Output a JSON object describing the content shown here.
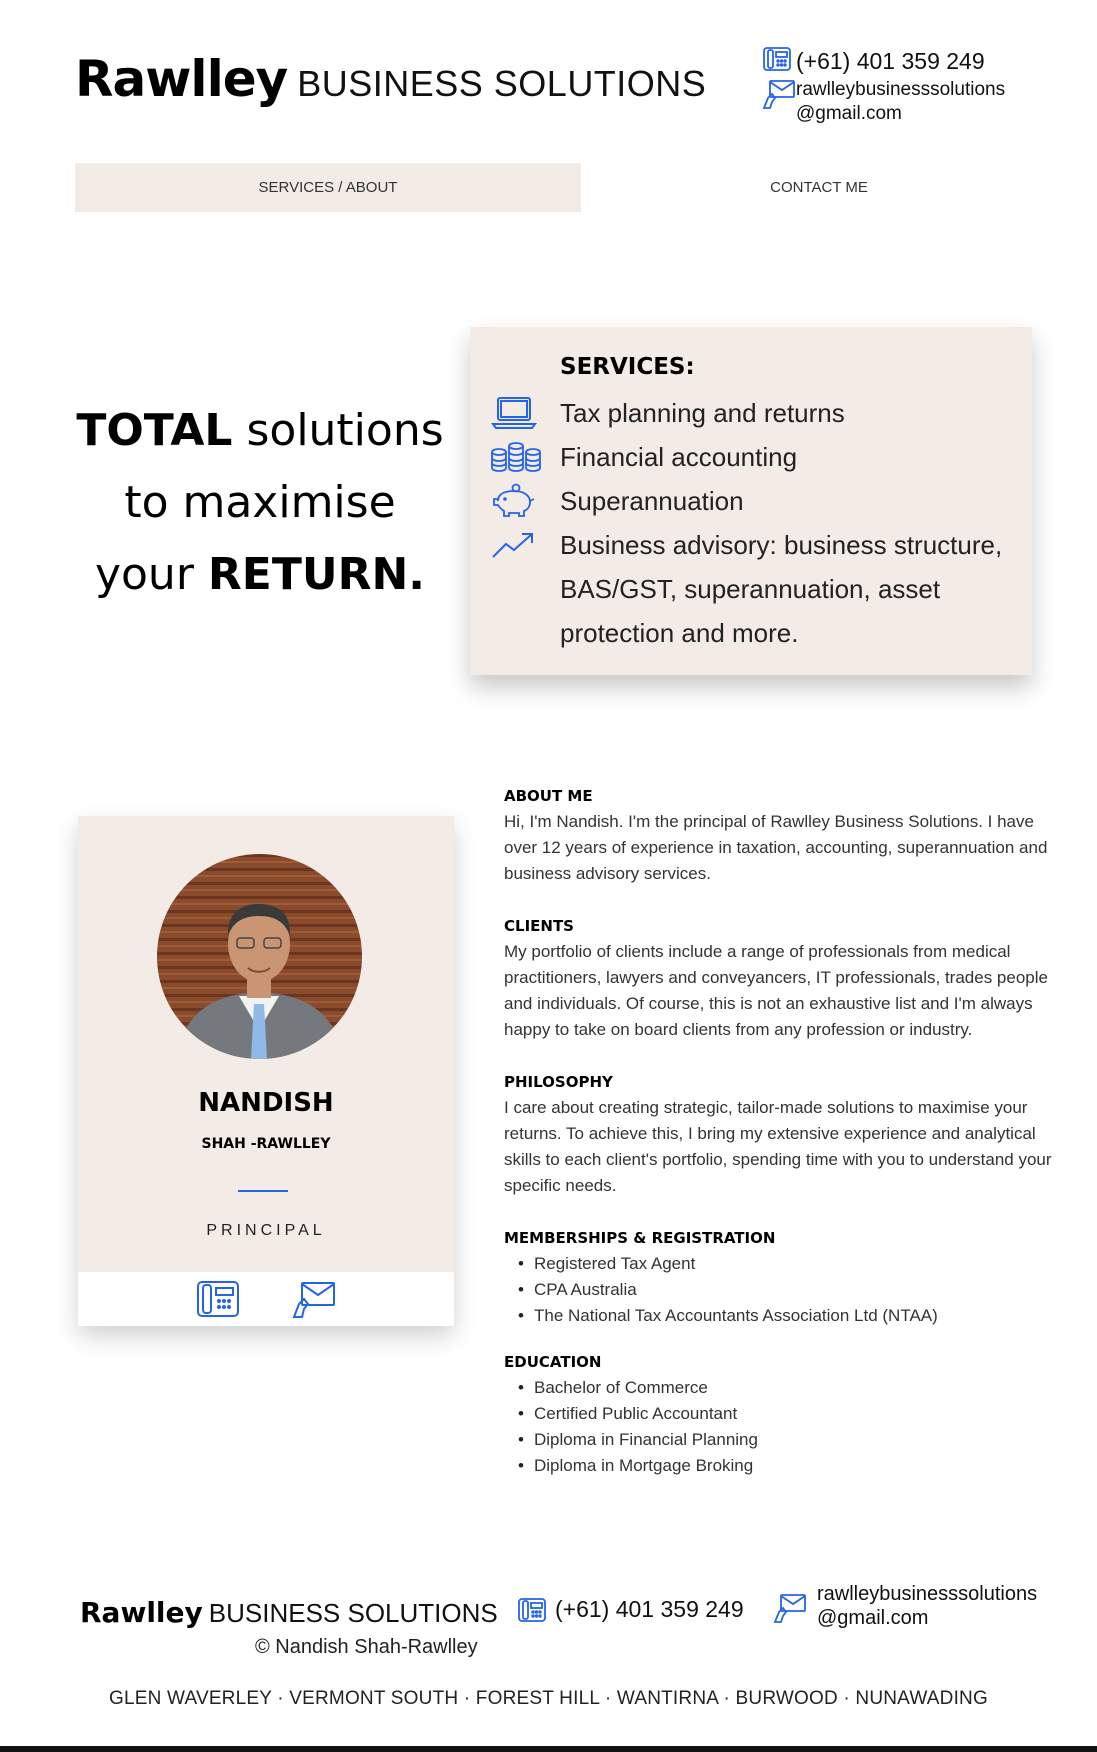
{
  "brand": {
    "name": "Rawlley",
    "tagline": "BUSINESS SOLUTIONS"
  },
  "contact": {
    "phone": "(+61) 401 359 249",
    "email_line1": "rawlleybusinesssolutions",
    "email_line2": "@gmail.com",
    "phone_icon": "phone-icon",
    "email_icon": "email-icon"
  },
  "nav": {
    "services_about": "SERVICES / ABOUT",
    "contact_me": "CONTACT ME"
  },
  "hero": {
    "line1_bold": "TOTAL",
    "line1_light": "solutions",
    "line2": "to maximise",
    "line3_light": "your",
    "line3_bold": "RETURN."
  },
  "services": {
    "title": "SERVICES:",
    "items": [
      {
        "icon": "laptop-icon",
        "label": "Tax planning and returns"
      },
      {
        "icon": "coins-icon",
        "label": "Financial accounting"
      },
      {
        "icon": "piggy-bank-icon",
        "label": "Superannuation"
      },
      {
        "icon": "trend-up-icon",
        "label": "Business advisory: business structure, BAS/GST, superannuation, asset protection and more."
      }
    ]
  },
  "profile": {
    "first_name": "NANDISH",
    "surname": "SHAH -RAWLLEY",
    "role": "PRINCIPAL"
  },
  "about": {
    "about_heading": "ABOUT ME",
    "about_text": "Hi, I'm Nandish. I'm the principal of Rawlley Business Solutions. I have over 12 years of experience in taxation, accounting, superannuation and business advisory services.",
    "clients_heading": "CLIENTS",
    "clients_text": "My portfolio of clients include a range of professionals from medical practitioners, lawyers and conveyancers, IT professionals, trades people and individuals. Of course, this is not an exhaustive list and I'm always happy to take on board clients from any profession or industry.",
    "philosophy_heading": "PHILOSOPHY",
    "philosophy_text": "I care about creating strategic, tailor-made solutions to maximise your returns. To achieve this, I bring my extensive experience and analytical skills to each client's portfolio, spending time with you to understand your specific needs.",
    "memberships_heading": "MEMBERSHIPS & REGISTRATION",
    "memberships": [
      "Registered Tax Agent",
      "CPA Australia",
      "The National Tax Accountants Association Ltd (NTAA)"
    ],
    "education_heading": "EDUCATION",
    "education": [
      "Bachelor of Commerce",
      "Certified Public Accountant",
      "Diploma in Financial Planning",
      "Diploma in Mortgage Broking"
    ]
  },
  "footer": {
    "copyright": "© Nandish Shah-Rawlley",
    "locations": "GLEN WAVERLEY · VERMONT SOUTH · FOREST HILL · WANTIRNA · BURWOOD · NUNAWADING"
  },
  "colors": {
    "accent": "#2563eb",
    "card_bg": "#f2ebe6"
  }
}
